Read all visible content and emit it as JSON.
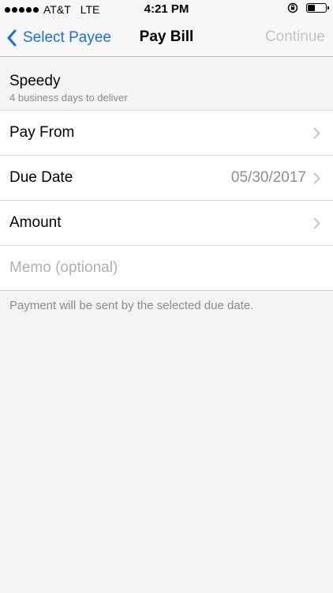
{
  "status": {
    "carrier": "AT&T",
    "network": "LTE",
    "time": "4:21 PM"
  },
  "nav": {
    "back_label": "Select Payee",
    "title": "Pay Bill",
    "continue_label": "Continue"
  },
  "delivery": {
    "title": "Speedy",
    "subtitle": "4 business days to deliver"
  },
  "form": {
    "pay_from_label": "Pay From",
    "due_date_label": "Due Date",
    "due_date_value": "05/30/2017",
    "amount_label": "Amount",
    "memo_placeholder": "Memo (optional)"
  },
  "note": "Payment will be sent by the selected due date.",
  "colors": {
    "accent": "#1a6fe0",
    "disabled": "#c3c3c3"
  }
}
